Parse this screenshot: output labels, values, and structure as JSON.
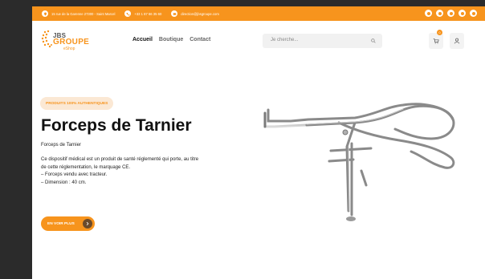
{
  "topbar": {
    "address": "15 rue de la Garenne 27300 - Saint Marcel",
    "phone": "+33 1 87 66 35 60",
    "email": "direction@jbsgroupe.com",
    "socials": [
      "facebook-icon",
      "instagram-icon",
      "linkedin-icon",
      "youtube-icon",
      "whatsapp-icon"
    ]
  },
  "header": {
    "logo": {
      "jbs": "JBS",
      "groupe": "GROUPE",
      "eshop": "eShop"
    },
    "nav": [
      "Accueil",
      "Boutique",
      "Contact"
    ],
    "search_placeholder": "Je cherche...",
    "cart_count": "0"
  },
  "hero": {
    "badge": "PRODUITS 100% AUTHENTIQUES",
    "title": "Forceps de Tarnier",
    "subtitle": "Forceps de Tarnier",
    "description": [
      "Ce dispositif médical est un produit de santé réglementé qui porte, au titre",
      "de cette réglementation, le marquage CE.",
      "– Forceps vendu avec tracteur.",
      "– Dimension : 40 cm."
    ],
    "cta": "EN VOIR PLUS"
  },
  "colors": {
    "accent": "#f7941d",
    "background": "#ffffff",
    "outer": "#2b2b2b"
  }
}
